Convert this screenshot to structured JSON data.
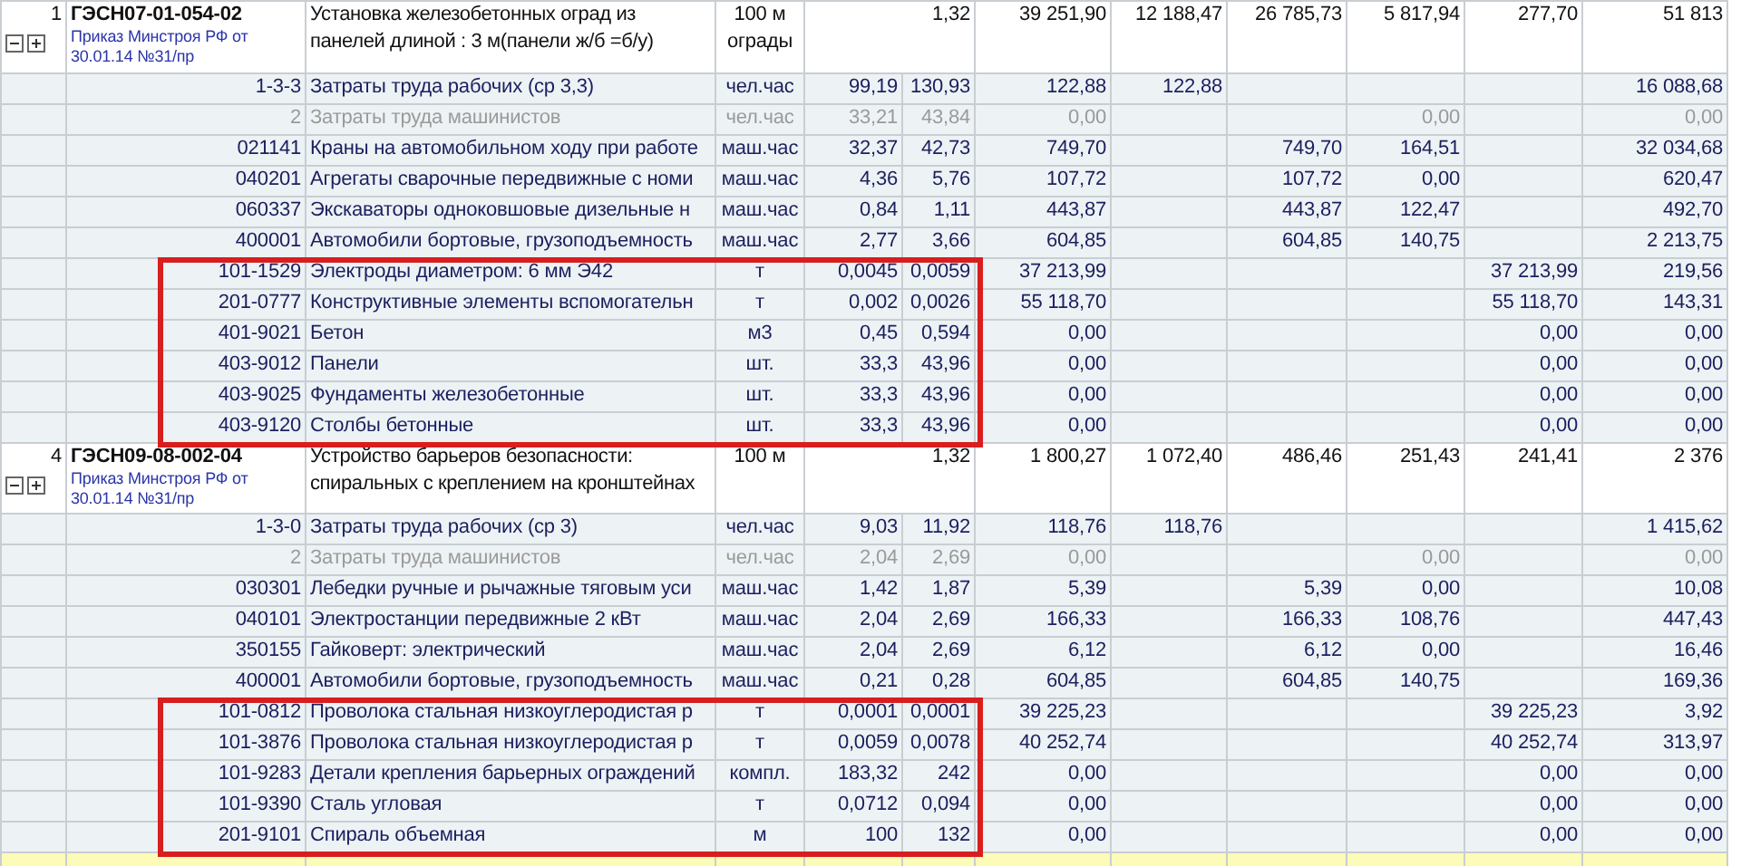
{
  "blocks": [
    {
      "number": "1",
      "code": "ГЭСН07-01-054-02",
      "order": "Приказ Минстроя РФ от 30.01.14 №31/пр",
      "name": "Установка железобетонных оград из панелей длиной : 3 м(панели ж/б =б/у)",
      "unit": "100 м ограды",
      "quantity": "1,32",
      "amounts": {
        "column_7": "39 251,90",
        "column_8": "12 188,47",
        "column_9": "26 785,73",
        "column_10": "5 817,94",
        "column_11": "277,70",
        "column_12": "51 813"
      },
      "resources": [
        {
          "code": "1-3-3",
          "name": "Затраты труда рабочих (ср 3,3)",
          "unit": "чел.час",
          "norm": "99,19",
          "quantity": "130,93",
          "amounts": {
            "column_7": "122,88",
            "column_8": "122,88",
            "column_12": "16 088,68"
          },
          "muted": false,
          "flagged": false
        },
        {
          "code": "2",
          "name": "Затраты труда машинистов",
          "unit": "чел.час",
          "norm": "33,21",
          "quantity": "43,84",
          "amounts": {
            "column_7": "0,00",
            "column_10": "0,00",
            "column_12": "0,00"
          },
          "muted": true,
          "flagged": false
        },
        {
          "code": "021141",
          "name": "Краны на автомобильном ходу при работе",
          "unit": "маш.час",
          "norm": "32,37",
          "quantity": "42,73",
          "amounts": {
            "column_7": "749,70",
            "column_9": "749,70",
            "column_10": "164,51",
            "column_12": "32 034,68"
          },
          "muted": false,
          "flagged": false
        },
        {
          "code": "040201",
          "name": "Агрегаты сварочные передвижные с номи",
          "unit": "маш.час",
          "norm": "4,36",
          "quantity": "5,76",
          "amounts": {
            "column_7": "107,72",
            "column_9": "107,72",
            "column_10": "0,00",
            "column_12": "620,47"
          },
          "muted": false,
          "flagged": false
        },
        {
          "code": "060337",
          "name": "Экскаваторы одноковшовые дизельные н",
          "unit": "маш.час",
          "norm": "0,84",
          "quantity": "1,11",
          "amounts": {
            "column_7": "443,87",
            "column_9": "443,87",
            "column_10": "122,47",
            "column_12": "492,70"
          },
          "muted": false,
          "flagged": false
        },
        {
          "code": "400001",
          "name": "Автомобили бортовые, грузоподъемность",
          "unit": "маш.час",
          "norm": "2,77",
          "quantity": "3,66",
          "amounts": {
            "column_7": "604,85",
            "column_9": "604,85",
            "column_10": "140,75",
            "column_12": "2 213,75"
          },
          "muted": false,
          "flagged": false
        },
        {
          "code": "101-1529",
          "name": "Электроды диаметром: 6 мм Э42",
          "unit": "т",
          "norm": "0,0045",
          "quantity": "0,0059",
          "amounts": {
            "column_7": "37 213,99",
            "column_11": "37 213,99",
            "column_12": "219,56"
          },
          "muted": false,
          "flagged": true
        },
        {
          "code": "201-0777",
          "name": "Конструктивные элементы вспомогательн",
          "unit": "т",
          "norm": "0,002",
          "quantity": "0,0026",
          "amounts": {
            "column_7": "55 118,70",
            "column_11": "55 118,70",
            "column_12": "143,31"
          },
          "muted": false,
          "flagged": true
        },
        {
          "code": "401-9021",
          "name": "Бетон",
          "unit": "м3",
          "norm": "0,45",
          "quantity": "0,594",
          "amounts": {
            "column_7": "0,00",
            "column_11": "0,00",
            "column_12": "0,00"
          },
          "muted": false,
          "flagged": true
        },
        {
          "code": "403-9012",
          "name": "Панели",
          "unit": "шт.",
          "norm": "33,3",
          "quantity": "43,96",
          "amounts": {
            "column_7": "0,00",
            "column_11": "0,00",
            "column_12": "0,00"
          },
          "muted": false,
          "flagged": true
        },
        {
          "code": "403-9025",
          "name": "Фундаменты железобетонные",
          "unit": "шт.",
          "norm": "33,3",
          "quantity": "43,96",
          "amounts": {
            "column_7": "0,00",
            "column_11": "0,00",
            "column_12": "0,00"
          },
          "muted": false,
          "flagged": true
        },
        {
          "code": "403-9120",
          "name": "Столбы бетонные",
          "unit": "шт.",
          "norm": "33,3",
          "quantity": "43,96",
          "amounts": {
            "column_7": "0,00",
            "column_11": "0,00",
            "column_12": "0,00"
          },
          "muted": false,
          "flagged": true
        }
      ]
    },
    {
      "number": "4",
      "code": "ГЭСН09-08-002-04",
      "order": "Приказ Минстроя РФ от 30.01.14 №31/пр",
      "name": "Устройство барьеров безопасности: спиральных с креплением на кронштейнах",
      "unit": "100 м",
      "quantity": "1,32",
      "amounts": {
        "column_7": "1 800,27",
        "column_8": "1 072,40",
        "column_9": "486,46",
        "column_10": "251,43",
        "column_11": "241,41",
        "column_12": "2 376"
      },
      "resources": [
        {
          "code": "1-3-0",
          "name": "Затраты труда рабочих (ср 3)",
          "unit": "чел.час",
          "norm": "9,03",
          "quantity": "11,92",
          "amounts": {
            "column_7": "118,76",
            "column_8": "118,76",
            "column_12": "1 415,62"
          },
          "muted": false,
          "flagged": false
        },
        {
          "code": "2",
          "name": "Затраты труда машинистов",
          "unit": "чел.час",
          "norm": "2,04",
          "quantity": "2,69",
          "amounts": {
            "column_7": "0,00",
            "column_10": "0,00",
            "column_12": "0,00"
          },
          "muted": true,
          "flagged": false
        },
        {
          "code": "030301",
          "name": "Лебедки ручные и рычажные тяговым уси",
          "unit": "маш.час",
          "norm": "1,42",
          "quantity": "1,87",
          "amounts": {
            "column_7": "5,39",
            "column_9": "5,39",
            "column_10": "0,00",
            "column_12": "10,08"
          },
          "muted": false,
          "flagged": false
        },
        {
          "code": "040101",
          "name": "Электростанции передвижные 2 кВт",
          "unit": "маш.час",
          "norm": "2,04",
          "quantity": "2,69",
          "amounts": {
            "column_7": "166,33",
            "column_9": "166,33",
            "column_10": "108,76",
            "column_12": "447,43"
          },
          "muted": false,
          "flagged": false
        },
        {
          "code": "350155",
          "name": "Гайковерт: электрический",
          "unit": "маш.час",
          "norm": "2,04",
          "quantity": "2,69",
          "amounts": {
            "column_7": "6,12",
            "column_9": "6,12",
            "column_10": "0,00",
            "column_12": "16,46"
          },
          "muted": false,
          "flagged": false
        },
        {
          "code": "400001",
          "name": "Автомобили бортовые, грузоподъемность",
          "unit": "маш.час",
          "norm": "0,21",
          "quantity": "0,28",
          "amounts": {
            "column_7": "604,85",
            "column_9": "604,85",
            "column_10": "140,75",
            "column_12": "169,36"
          },
          "muted": false,
          "flagged": false
        },
        {
          "code": "101-0812",
          "name": "Проволока стальная низкоуглеродистая р",
          "unit": "т",
          "norm": "0,0001",
          "quantity": "0,0001",
          "amounts": {
            "column_7": "39 225,23",
            "column_11": "39 225,23",
            "column_12": "3,92"
          },
          "muted": false,
          "flagged": true
        },
        {
          "code": "101-3876",
          "name": "Проволока стальная низкоуглеродистая р",
          "unit": "т",
          "norm": "0,0059",
          "quantity": "0,0078",
          "amounts": {
            "column_7": "40 252,74",
            "column_11": "40 252,74",
            "column_12": "313,97"
          },
          "muted": false,
          "flagged": true
        },
        {
          "code": "101-9283",
          "name": "Детали крепления барьерных ограждений",
          "unit": "компл.",
          "norm": "183,32",
          "quantity": "242",
          "amounts": {
            "column_7": "0,00",
            "column_11": "0,00",
            "column_12": "0,00"
          },
          "muted": false,
          "flagged": true
        },
        {
          "code": "101-9390",
          "name": "Сталь угловая",
          "unit": "т",
          "norm": "0,0712",
          "quantity": "0,094",
          "amounts": {
            "column_7": "0,00",
            "column_11": "0,00",
            "column_12": "0,00"
          },
          "muted": false,
          "flagged": true
        },
        {
          "code": "201-9101",
          "name": "Спираль объемная",
          "unit": "м",
          "norm": "100",
          "quantity": "132",
          "amounts": {
            "column_7": "0,00",
            "column_11": "0,00",
            "column_12": "0,00"
          },
          "muted": false,
          "flagged": true
        }
      ]
    }
  ]
}
